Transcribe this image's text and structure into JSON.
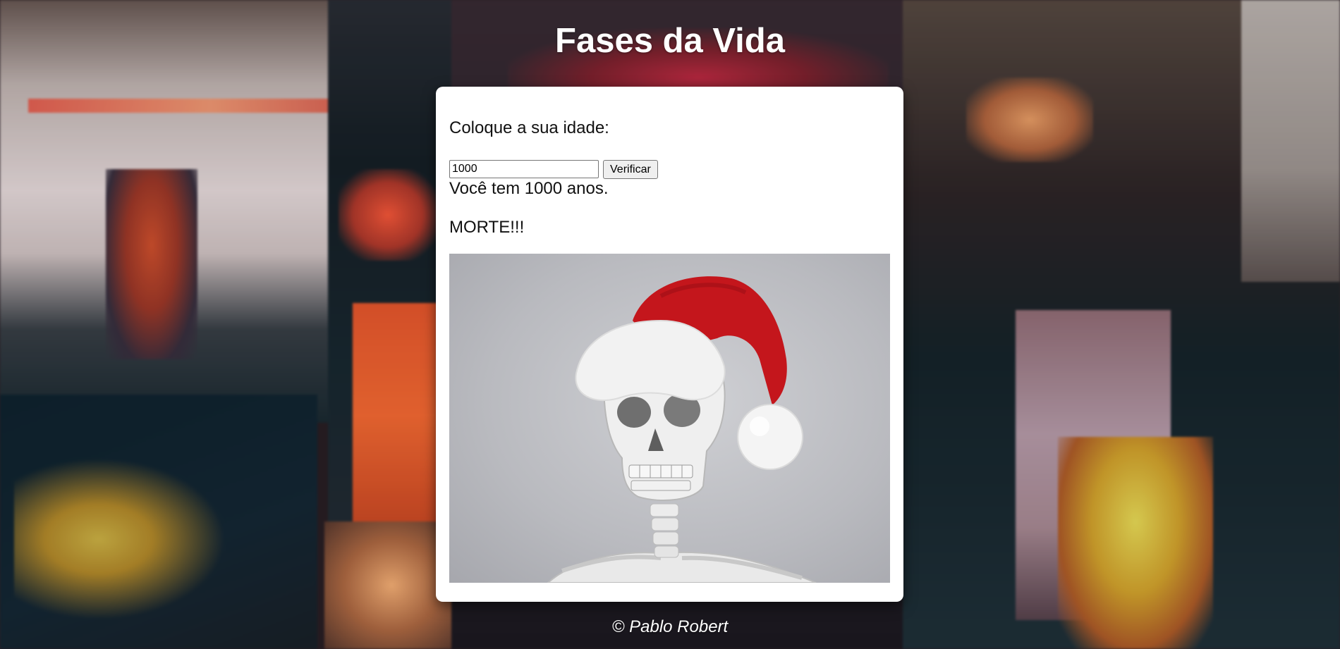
{
  "header": {
    "title": "Fases da Vida"
  },
  "form": {
    "prompt": "Coloque a sua idade:",
    "age_value": "1000",
    "verify_label": "Verificar"
  },
  "result": {
    "age_text": "Você tem 1000 anos.",
    "phase_text": "MORTE!!!"
  },
  "image": {
    "subject": "skeleton-with-santa-hat"
  },
  "footer": {
    "credit": "© Pablo Robert"
  },
  "colors": {
    "card_background": "#ffffff",
    "title_color": "#ffffff",
    "hat_red": "#c4161c",
    "hat_fur": "#f2f2f2"
  }
}
